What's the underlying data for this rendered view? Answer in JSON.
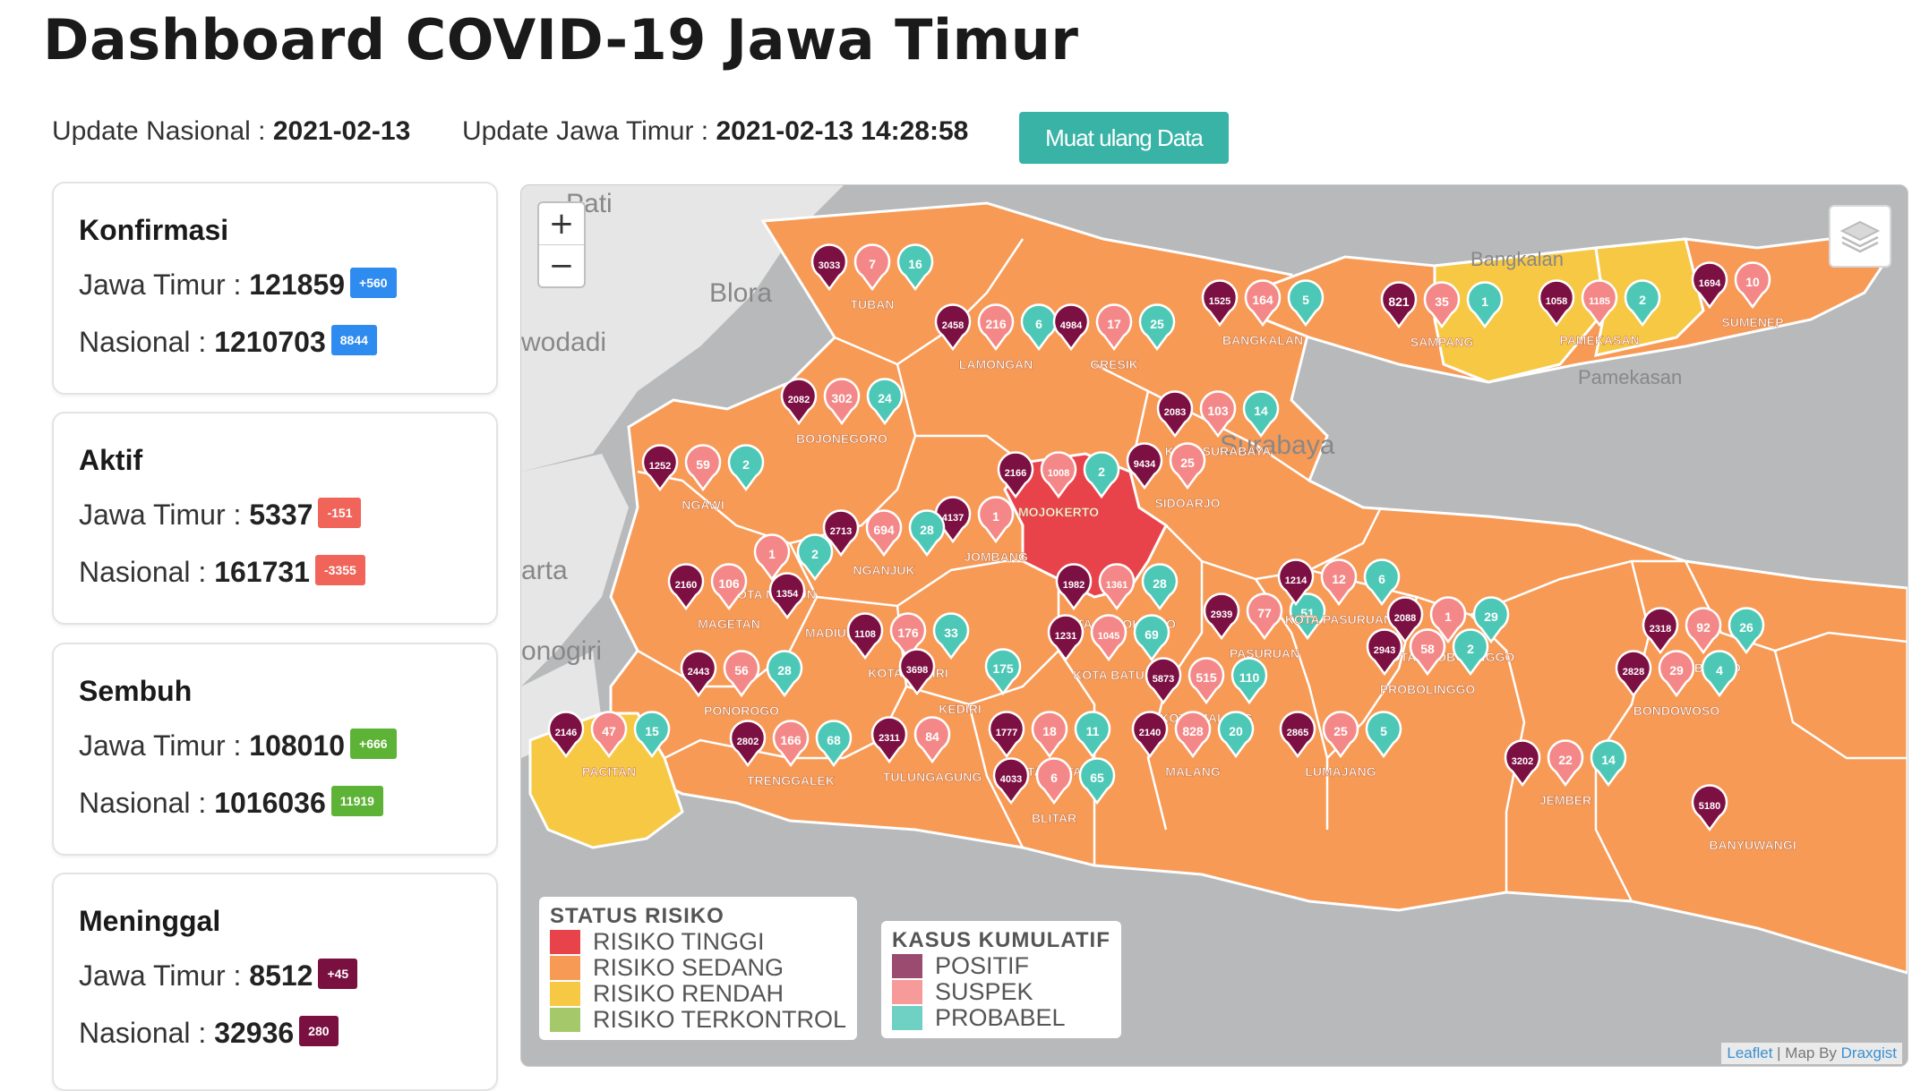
{
  "title": "Dashboard COVID-19 Jawa Timur",
  "update": {
    "nasional_label": "Update Nasional :",
    "nasional_value": "2021-02-13",
    "jatim_label": "Update Jawa Timur :",
    "jatim_value": "2021-02-13 14:28:58",
    "reload_button": "Muat ulang Data"
  },
  "cards": [
    {
      "title": "Konfirmasi",
      "jatim_label": "Jawa Timur :",
      "jatim_value": "121859",
      "jatim_delta": "+560",
      "nas_label": "Nasional :",
      "nas_value": "1210703",
      "nas_delta": "8844",
      "color": "#2e8bef"
    },
    {
      "title": "Aktif",
      "jatim_label": "Jawa Timur :",
      "jatim_value": "5337",
      "jatim_delta": "-151",
      "nas_label": "Nasional :",
      "nas_value": "161731",
      "nas_delta": "-3355",
      "color": "#f0645a"
    },
    {
      "title": "Sembuh",
      "jatim_label": "Jawa Timur :",
      "jatim_value": "108010",
      "jatim_delta": "+666",
      "nas_label": "Nasional :",
      "nas_value": "1016036",
      "nas_delta": "11919",
      "color": "#5cb335"
    },
    {
      "title": "Meninggal",
      "jatim_label": "Jawa Timur :",
      "jatim_value": "8512",
      "jatim_delta": "+45",
      "nas_label": "Nasional :",
      "nas_value": "32936",
      "nas_delta": "280",
      "color": "#7a1040"
    }
  ],
  "map": {
    "zoom_in": "+",
    "zoom_out": "−",
    "layers_icon": "layers-icon",
    "base_labels": [
      "Pati",
      "Blora",
      "wodadi",
      "arta",
      "onogiri",
      "Bangkalan",
      "Pamekasan",
      "Surabaya"
    ],
    "colors": {
      "tinggi": "#e8424a",
      "sedang": "#f79a56",
      "rendah": "#f7c844",
      "terkontrol": "#a5c96a",
      "positif": "#7d1043",
      "suspek": "#f48888",
      "probabel": "#4ec8b6",
      "sea": "#b7b9bb"
    },
    "regions": [
      {
        "name": "TUBAN",
        "risk": "sedang",
        "pos": "3033",
        "sus": "7",
        "prob": "16"
      },
      {
        "name": "LAMONGAN",
        "risk": "sedang",
        "pos": "2458",
        "sus": "216",
        "prob": "6"
      },
      {
        "name": "GRESIK",
        "risk": "sedang",
        "pos": "4984",
        "sus": "17",
        "prob": "25"
      },
      {
        "name": "BANGKALAN",
        "risk": "sedang",
        "pos": "1525",
        "sus": "164",
        "prob": "5"
      },
      {
        "name": "SAMPANG",
        "risk": "rendah",
        "pos": "821",
        "sus": "35",
        "prob": "1"
      },
      {
        "name": "PAMEKASAN",
        "risk": "rendah",
        "pos": "1058",
        "sus": "1185",
        "prob": "2"
      },
      {
        "name": "SUMENEP",
        "risk": "sedang",
        "pos": "1694",
        "sus": "10",
        "prob": ""
      },
      {
        "name": "BOJONEGORO",
        "risk": "sedang",
        "pos": "2082",
        "sus": "302",
        "prob": "24"
      },
      {
        "name": "KOTA SURABAYA",
        "risk": "sedang",
        "pos": "2083",
        "sus": "103",
        "prob": "14"
      },
      {
        "name": "NGAWI",
        "risk": "sedang",
        "pos": "1252",
        "sus": "59",
        "prob": "2"
      },
      {
        "name": "SIDOARJO",
        "risk": "sedang",
        "pos": "9434",
        "sus": "25",
        "prob": ""
      },
      {
        "name": "MOJOKERTO",
        "risk": "sedang",
        "pos": "2166",
        "sus": "1008",
        "prob": "2"
      },
      {
        "name": "JOMBANG",
        "risk": "tinggi",
        "pos": "4137",
        "sus": "1",
        "prob": ""
      },
      {
        "name": "NGANJUK",
        "risk": "sedang",
        "pos": "2713",
        "sus": "694",
        "prob": "28"
      },
      {
        "name": "KOTA MADIUN",
        "risk": "sedang",
        "pos": "",
        "sus": "1",
        "prob": "2"
      },
      {
        "name": "MAGETAN",
        "risk": "sedang",
        "pos": "2160",
        "sus": "106",
        "prob": ""
      },
      {
        "name": "MADIUN",
        "risk": "sedang",
        "pos": "1354",
        "sus": "",
        "prob": ""
      },
      {
        "name": "KOTA MOJOKERTO",
        "risk": "sedang",
        "pos": "1982",
        "sus": "1361",
        "prob": "28"
      },
      {
        "name": "PASURUAN",
        "risk": "sedang",
        "pos": "2939",
        "sus": "77",
        "prob": "51"
      },
      {
        "name": "KOTA PASURUAN",
        "risk": "sedang",
        "pos": "1214",
        "sus": "12",
        "prob": "6"
      },
      {
        "name": "KOTA PROBOLINGGO",
        "risk": "sedang",
        "pos": "2088",
        "sus": "1",
        "prob": "29"
      },
      {
        "name": "SITUBONDO",
        "risk": "sedang",
        "pos": "2318",
        "sus": "92",
        "prob": "26"
      },
      {
        "name": "KOTA KEDIRI",
        "risk": "sedang",
        "pos": "1108",
        "sus": "176",
        "prob": "33"
      },
      {
        "name": "KOTA BATU",
        "risk": "sedang",
        "pos": "1231",
        "sus": "1045",
        "prob": "69"
      },
      {
        "name": "KEDIRI",
        "risk": "sedang",
        "pos": "3698",
        "sus": "",
        "prob": "175"
      },
      {
        "name": "PROBOLINGGO",
        "risk": "sedang",
        "pos": "2943",
        "sus": "58",
        "prob": "2"
      },
      {
        "name": "PONOROGO",
        "risk": "sedang",
        "pos": "2443",
        "sus": "56",
        "prob": "28"
      },
      {
        "name": "BONDOWOSO",
        "risk": "sedang",
        "pos": "2828",
        "sus": "29",
        "prob": "4"
      },
      {
        "name": "KOTA MALANG",
        "risk": "sedang",
        "pos": "5873",
        "sus": "515",
        "prob": "110"
      },
      {
        "name": "PACITAN",
        "risk": "rendah",
        "pos": "2146",
        "sus": "47",
        "prob": "15"
      },
      {
        "name": "TRENGGALEK",
        "risk": "sedang",
        "pos": "2802",
        "sus": "166",
        "prob": "68"
      },
      {
        "name": "TULUNGAGUNG",
        "risk": "sedang",
        "pos": "2311",
        "sus": "84",
        "prob": ""
      },
      {
        "name": "KOTA BLITAR",
        "risk": "sedang",
        "pos": "1777",
        "sus": "18",
        "prob": "11"
      },
      {
        "name": "MALANG",
        "risk": "sedang",
        "pos": "2140",
        "sus": "828",
        "prob": "20"
      },
      {
        "name": "LUMAJANG",
        "risk": "sedang",
        "pos": "2865",
        "sus": "25",
        "prob": "5"
      },
      {
        "name": "JEMBER",
        "risk": "sedang",
        "pos": "3202",
        "sus": "22",
        "prob": "14"
      },
      {
        "name": "BLITAR",
        "risk": "sedang",
        "pos": "4033",
        "sus": "6",
        "prob": "65"
      },
      {
        "name": "BANYUWANGI",
        "risk": "sedang",
        "pos": "5180",
        "sus": "",
        "prob": ""
      }
    ],
    "legend_status": {
      "title": "STATUS RISIKO",
      "items": [
        {
          "label": "RISIKO TINGGI",
          "color": "#e8424a"
        },
        {
          "label": "RISIKO SEDANG",
          "color": "#f79a56"
        },
        {
          "label": "RISIKO RENDAH",
          "color": "#f7c844"
        },
        {
          "label": "RISIKO TERKONTROL",
          "color": "#a5c96a"
        }
      ]
    },
    "legend_kasus": {
      "title": "KASUS KUMULATIF",
      "items": [
        {
          "label": "POSITIF",
          "color": "#9b4a70"
        },
        {
          "label": "SUSPEK",
          "color": "#f79a9a"
        },
        {
          "label": "PROBABEL",
          "color": "#6fd0c4"
        }
      ]
    },
    "attribution": {
      "leaflet": "Leaflet",
      "sep": " | Map By ",
      "author": "Draxgist"
    }
  }
}
